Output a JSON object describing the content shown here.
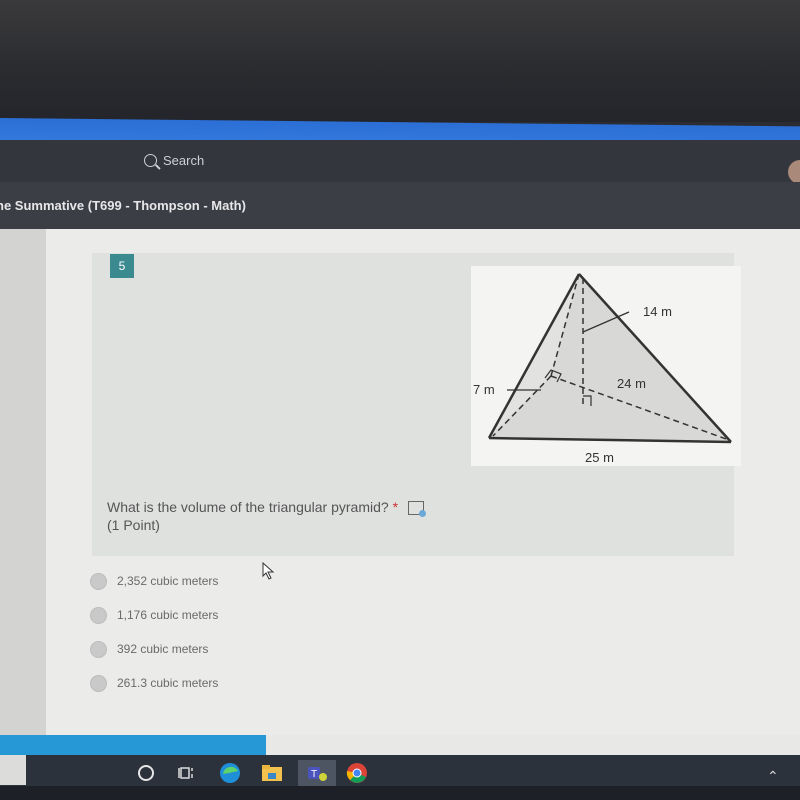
{
  "header": {
    "search_placeholder": "Search",
    "form_title": "ne Summative (T699 - Thompson - Math)"
  },
  "question": {
    "number": "5",
    "text": "What is the volume of the triangular pyramid?",
    "required_marker": "*",
    "points": "(1 Point)",
    "figure": {
      "labels": {
        "slant": "14 m",
        "height_of_base": "24 m",
        "side": "7 m",
        "base": "25 m"
      }
    },
    "options": [
      {
        "label": "2,352 cubic meters",
        "selected": false
      },
      {
        "label": "1,176 cubic meters",
        "selected": false
      },
      {
        "label": "392 cubic meters",
        "selected": false
      },
      {
        "label": "261.3 cubic meters",
        "selected": false
      }
    ]
  },
  "taskbar": {
    "items": [
      "cortana-search",
      "task-view",
      "edge",
      "file-explorer",
      "teams",
      "chrome"
    ],
    "active": "teams"
  },
  "colors": {
    "accent_blue": "#2b6fd6",
    "question_badge": "#3b8a90",
    "required": "#cc3333"
  }
}
